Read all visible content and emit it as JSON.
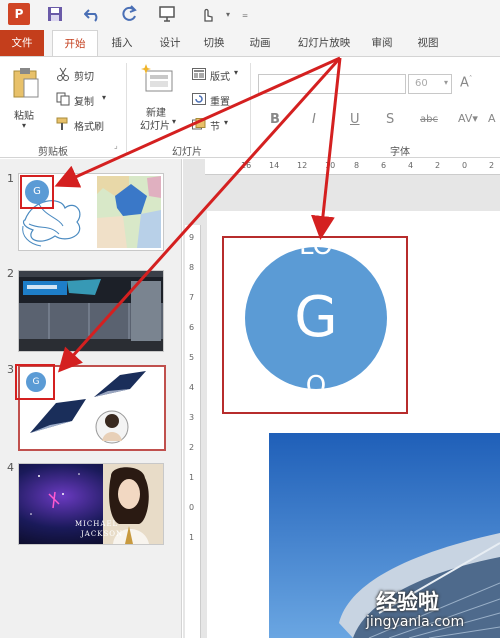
{
  "tabs": {
    "file": "文件",
    "home": "开始",
    "insert": "插入",
    "design": "设计",
    "transitions": "切换",
    "animations": "动画",
    "slideshow": "幻灯片放映",
    "review": "审阅",
    "view": "视图"
  },
  "ribbon": {
    "paste": "粘贴",
    "cut": "剪切",
    "copy": "复制",
    "format_painter": "格式刷",
    "clipboard_group": "剪贴板",
    "new_slide_line1": "新建",
    "new_slide_line2": "幻灯片",
    "layout": "版式",
    "reset": "重置",
    "section": "节",
    "slides_group": "幻灯片",
    "font_size": "60",
    "font_group": "字体"
  },
  "slides": [
    {
      "number": "1",
      "badge": "G"
    },
    {
      "number": "2"
    },
    {
      "number": "3",
      "badge": "G"
    },
    {
      "number": "4",
      "caption_line1": "MICHAEL",
      "caption_line2": "JACKSON"
    }
  ],
  "hruler_ticks": [
    "16",
    "14",
    "12",
    "10",
    "8",
    "6",
    "4",
    "2",
    "0",
    "2"
  ],
  "vruler_ticks": [
    "9",
    "8",
    "7",
    "6",
    "5",
    "4",
    "3",
    "2",
    "1",
    "0",
    "1"
  ],
  "main_slide": {
    "circle_letter": "G"
  },
  "watermark": {
    "cn": "经验啦",
    "en": "jingyanla.com"
  },
  "colors": {
    "accent": "#c43e1c",
    "highlight_red": "#c0504d",
    "arrow": "#d42020",
    "circle": "#5b9bd5"
  }
}
